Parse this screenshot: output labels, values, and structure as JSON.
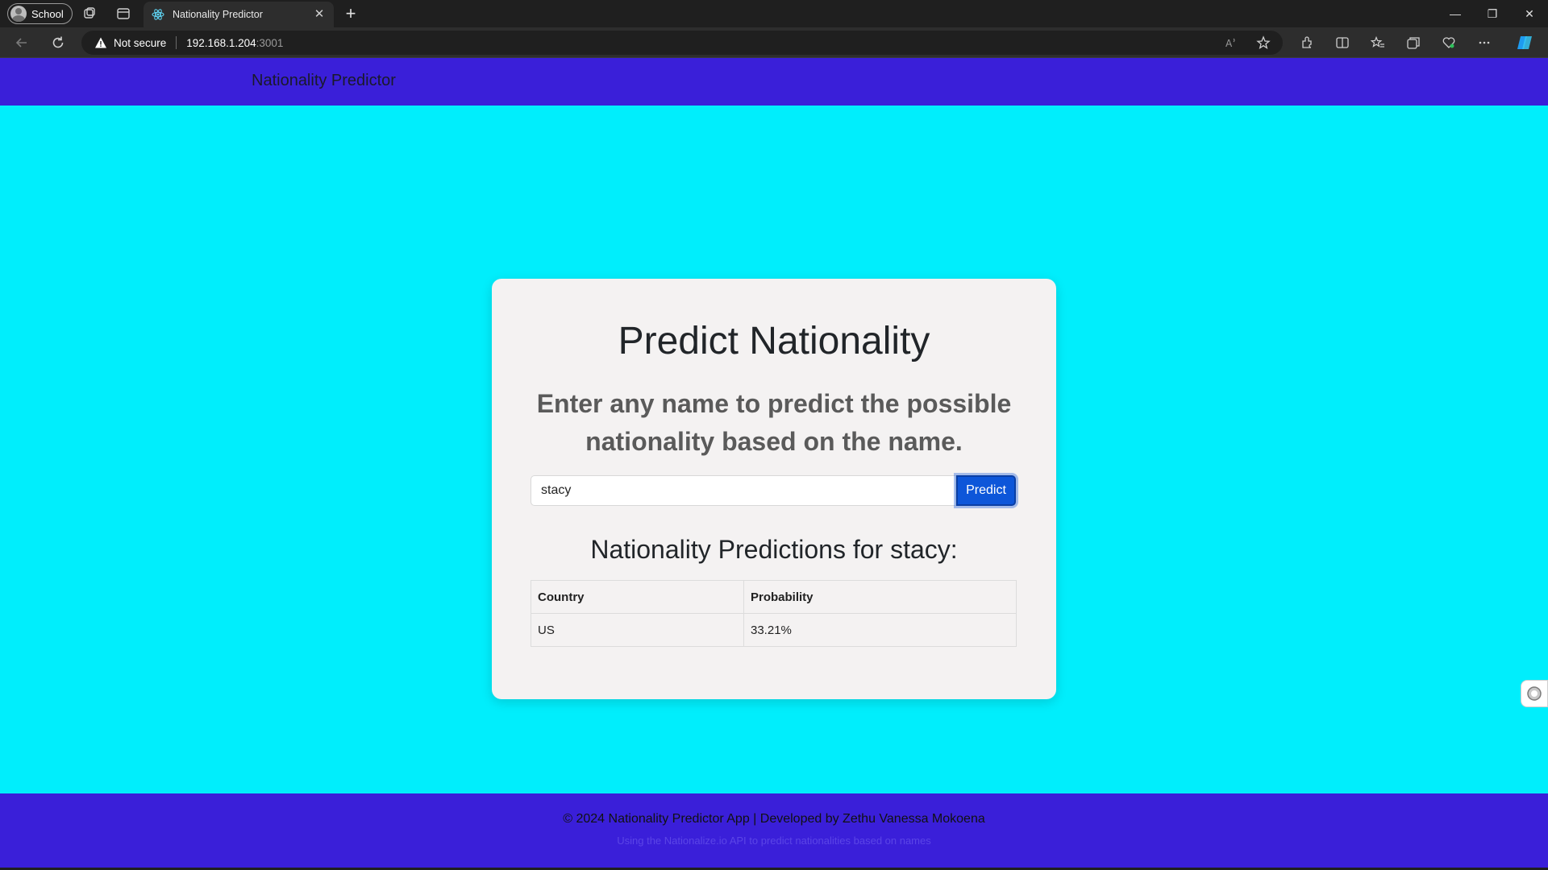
{
  "browser": {
    "profile_label": "School",
    "tab_title": "Nationality Predictor",
    "address": {
      "security_label": "Not secure",
      "host": "192.168.1.204",
      "port": ":3001"
    }
  },
  "header": {
    "brand": "Nationality Predictor"
  },
  "main": {
    "title": "Predict Nationality",
    "subtitle": "Enter any name to predict the possible nationality based on the name.",
    "input_value": "stacy",
    "predict_label": "Predict",
    "results_title": "Nationality Predictions for stacy:",
    "table": {
      "headers": [
        "Country",
        "Probability"
      ],
      "rows": [
        [
          "US",
          "33.21%"
        ]
      ]
    }
  },
  "footer": {
    "line1": "© 2024 Nationality Predictor App | Developed by Zethu Vanessa Mokoena",
    "line2": "Using the Nationalize.io API to predict nationalities based on names"
  },
  "colors": {
    "page_background": "#00eefc",
    "header_footer": "#3a1fd9",
    "button": "#0d56d9"
  }
}
